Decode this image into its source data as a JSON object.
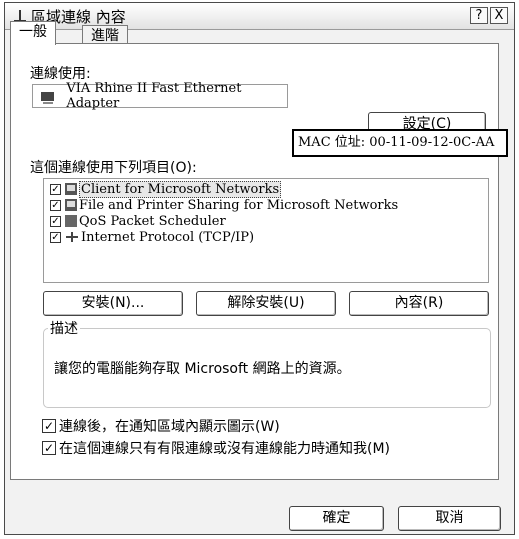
{
  "window": {
    "title": "區域連線 內容",
    "help_button": "?",
    "close_button": "X"
  },
  "tabs": [
    {
      "label": "一般"
    },
    {
      "label": "進階"
    }
  ],
  "connect_using": {
    "label": "連線使用:",
    "adapter_name": "VIA Rhine II Fast Ethernet Adapter",
    "configure_button": "設定(C)"
  },
  "mac_callout": {
    "text": "MAC 位址: 00-11-09-12-0C-AA"
  },
  "components": {
    "label": "這個連線使用下列項目(O):",
    "items": [
      {
        "label": "Client for Microsoft Networks",
        "checked": true,
        "icon": "network-client-icon"
      },
      {
        "label": "File and Printer Sharing for Microsoft Networks",
        "checked": true,
        "icon": "file-printer-sharing-icon"
      },
      {
        "label": "QoS Packet Scheduler",
        "checked": true,
        "icon": "qos-scheduler-icon"
      },
      {
        "label": "Internet Protocol (TCP/IP)",
        "checked": true,
        "icon": "protocol-icon"
      }
    ]
  },
  "buttons": {
    "install": "安裝(N)...",
    "uninstall": "解除安裝(U)",
    "properties": "內容(R)",
    "ok": "確定",
    "cancel": "取消"
  },
  "description": {
    "legend": "描述",
    "text": "讓您的電腦能夠存取 Microsoft 網路上的資源。"
  },
  "options": [
    {
      "label": "連線後，在通知區域內顯示圖示(W)",
      "checked": true
    },
    {
      "label": "在這個連線只有有限連線或沒有連線能力時通知我(M)",
      "checked": true
    }
  ],
  "checkmark_glyph": "✓"
}
